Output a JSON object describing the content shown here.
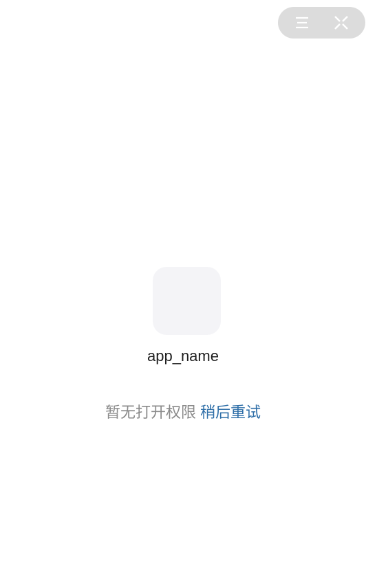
{
  "capsule": {
    "menu_icon": "menu-icon",
    "close_icon": "close-icon"
  },
  "app": {
    "name": "app_name",
    "icon": "app-icon-placeholder"
  },
  "status": {
    "message": "暂无打开权限",
    "retry_label": "稍后重试"
  },
  "colors": {
    "capsule_bg": "#dcdcdc",
    "icon_bg": "#f4f4f7",
    "message_text": "#8a8a8a",
    "link_text": "#2f6fa8"
  }
}
